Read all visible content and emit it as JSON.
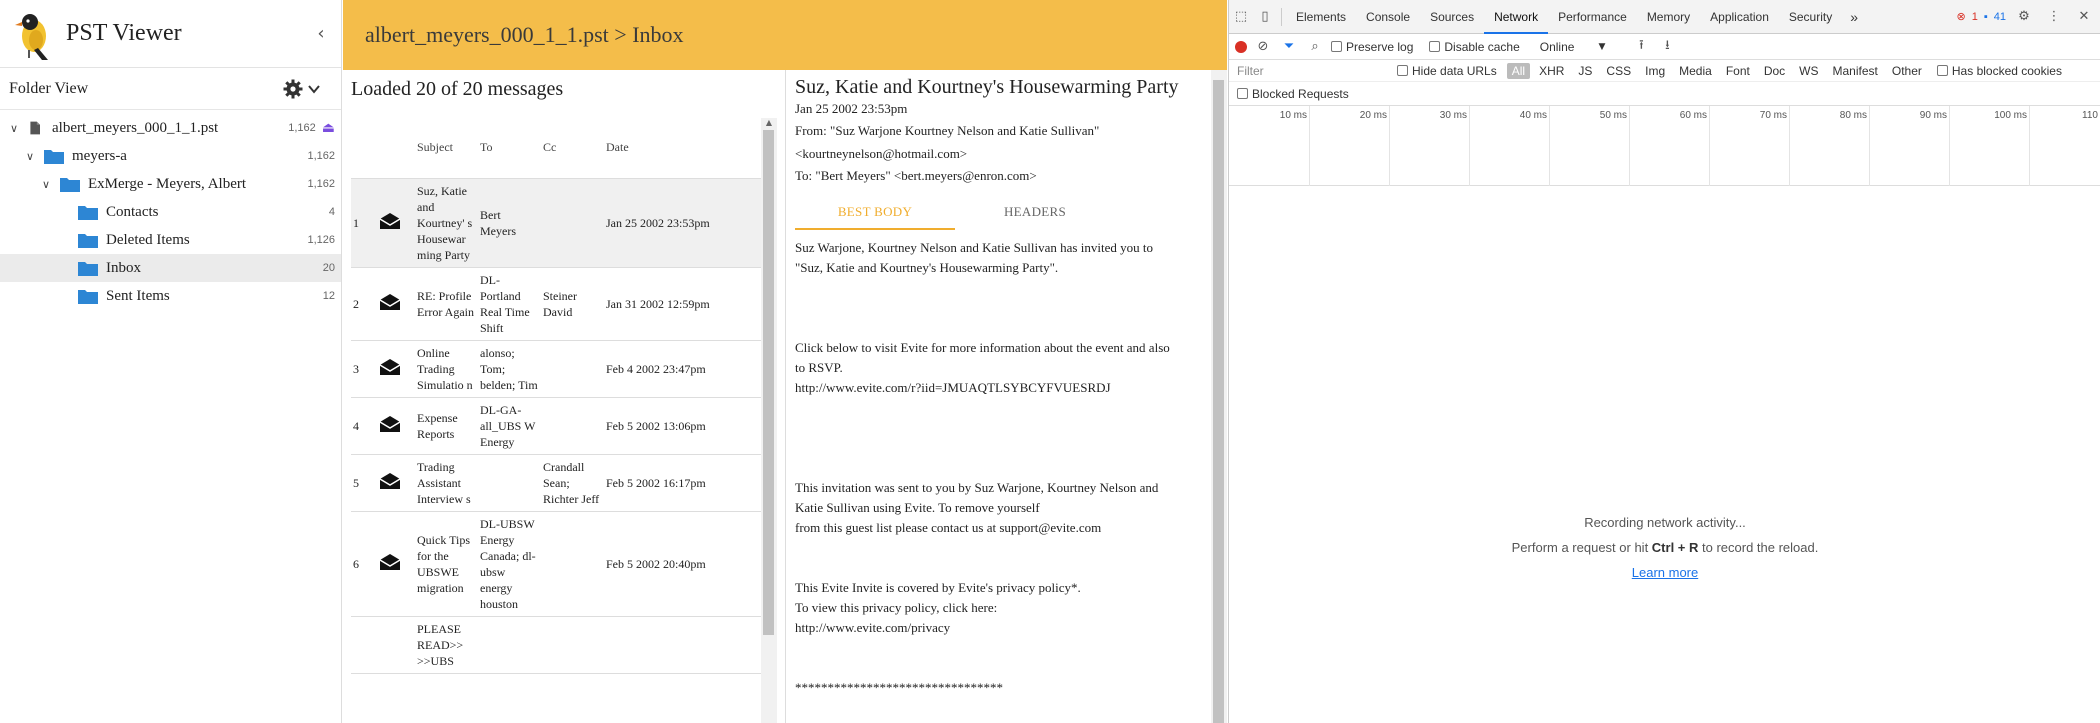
{
  "app": {
    "title": "PST Viewer",
    "collapse_glyph": "‹",
    "accent": "#f4bd4a",
    "folder_view_label": "Folder View"
  },
  "tree": [
    {
      "label": "albert_meyers_000_1_1.pst",
      "count": "1,162",
      "type": "file",
      "eject": "⏏"
    },
    {
      "label": "meyers-a",
      "count": "1,162",
      "type": "folder"
    },
    {
      "label": "ExMerge - Meyers, Albert",
      "count": "1,162",
      "type": "folder"
    },
    {
      "label": "Contacts",
      "count": "4",
      "type": "folder"
    },
    {
      "label": "Deleted Items",
      "count": "1,126",
      "type": "folder"
    },
    {
      "label": "Inbox",
      "count": "20",
      "type": "folder"
    },
    {
      "label": "Sent Items",
      "count": "12",
      "type": "folder"
    }
  ],
  "breadcrumb": "albert_meyers_000_1_1.pst > Inbox",
  "list": {
    "heading": "Loaded 20 of 20 messages",
    "columns": {
      "subject": "Subject",
      "to": "To",
      "cc": "Cc",
      "date": "Date"
    },
    "rows": [
      {
        "num": "1",
        "subject": "Suz, Katie and Kourtney' s Housewar ming Party",
        "to": "Bert Meyers",
        "cc": "",
        "date": "Jan 25 2002 23:53pm"
      },
      {
        "num": "2",
        "subject": "RE: Profile Error Again",
        "to": "DL-Portland Real Time Shift",
        "cc": "Steiner David",
        "date": "Jan 31 2002 12:59pm"
      },
      {
        "num": "3",
        "subject": "Online Trading Simulatio n",
        "to": "alonso; Tom; belden; Tim",
        "cc": "",
        "date": "Feb 4 2002 23:47pm"
      },
      {
        "num": "4",
        "subject": "Expense Reports",
        "to": "DL-GA-all_UBS W Energy",
        "cc": "",
        "date": "Feb 5 2002 13:06pm"
      },
      {
        "num": "5",
        "subject": "Trading Assistant Interview s",
        "to": "",
        "cc": "Crandall Sean; Richter Jeff",
        "date": "Feb 5 2002 16:17pm"
      },
      {
        "num": "6",
        "subject": "Quick Tips for the UBSWE migration",
        "to": "DL-UBSW Energy Canada; dl-ubsw energy houston",
        "cc": "",
        "date": "Feb 5 2002 20:40pm"
      },
      {
        "num": "",
        "subject": "PLEASE READ>> >>UBS",
        "to": "",
        "cc": "",
        "date": ""
      }
    ]
  },
  "reading": {
    "subject": "Suz, Katie and Kourtney's Housewarming Party",
    "date": "Jan 25 2002 23:53pm",
    "from_line1": "From: \"Suz Warjone Kourtney Nelson and Katie Sullivan\"",
    "from_line2": "<kourtneynelson@hotmail.com>",
    "to_line": "To: \"Bert Meyers\" <bert.meyers@enron.com>",
    "tab_best": "BEST BODY",
    "tab_headers": "HEADERS",
    "body": [
      "Suz Warjone, Kourtney Nelson and Katie Sullivan has invited you to\n\"Suz, Katie and Kourtney's Housewarming Party\".",
      "\n\n\nClick below to visit Evite for more information about the event and also\nto RSVP.\nhttp://www.evite.com/r?iid=JMUAQTLSYBCYFVUESRDJ",
      "\n\n\n\nThis invitation was sent to you by Suz Warjone, Kourtney Nelson and\nKatie Sullivan using Evite. To remove yourself\nfrom this guest list please contact us at support@evite.com",
      "\n\nThis Evite Invite is covered by Evite's privacy policy*.\nTo view this privacy policy, click here:\nhttp://www.evite.com/privacy",
      "\n\n********************************"
    ]
  },
  "devtools": {
    "tabs": [
      "Elements",
      "Console",
      "Sources",
      "Network",
      "Performance",
      "Memory",
      "Application",
      "Security"
    ],
    "active_tab": "Network",
    "more": "»",
    "errors": "1",
    "messages": "41",
    "toolbar": {
      "preserve_log": "Preserve log",
      "disable_cache": "Disable cache",
      "throttle": "Online"
    },
    "filter_placeholder": "Filter",
    "hide_data_urls": "Hide data URLs",
    "types": [
      "All",
      "XHR",
      "JS",
      "CSS",
      "Img",
      "Media",
      "Font",
      "Doc",
      "WS",
      "Manifest",
      "Other"
    ],
    "has_blocked_cookies": "Has blocked cookies",
    "blocked_requests": "Blocked Requests",
    "ticks": [
      "10 ms",
      "20 ms",
      "30 ms",
      "40 ms",
      "50 ms",
      "60 ms",
      "70 ms",
      "80 ms",
      "90 ms",
      "100 ms",
      "110"
    ],
    "empty_line1": "Recording network activity...",
    "empty_line2_pre": "Perform a request or hit ",
    "empty_line2_key": "Ctrl + R",
    "empty_line2_post": " to record the reload.",
    "learn_more": "Learn more"
  }
}
